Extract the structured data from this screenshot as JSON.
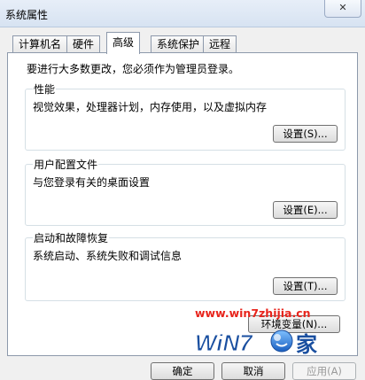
{
  "window": {
    "title": "系统属性",
    "close_label": "✕"
  },
  "tabs": [
    {
      "label": "计算机名",
      "active": false
    },
    {
      "label": "硬件",
      "active": false
    },
    {
      "label": "高级",
      "active": true
    },
    {
      "label": "系统保护",
      "active": false
    },
    {
      "label": "远程",
      "active": false
    }
  ],
  "intro_text": "要进行大多数更改，您必须作为管理员登录。",
  "groups": {
    "performance": {
      "title": "性能",
      "description": "视觉效果，处理器计划，内存使用，以及虚拟内存",
      "button_label": "设置(S)..."
    },
    "user_profiles": {
      "title": "用户配置文件",
      "description": "与您登录有关的桌面设置",
      "button_label": "设置(E)..."
    },
    "startup_recovery": {
      "title": "启动和故障恢复",
      "description": "系统启动、系统失败和调试信息",
      "button_label": "设置(T)..."
    }
  },
  "env_button_label": "环境变量(N)...",
  "footer": {
    "ok_label": "确定",
    "cancel_label": "取消",
    "apply_label": "应用(A)"
  },
  "watermark": {
    "url": "www.win7zhijia.cn",
    "logo_text": "WiN7",
    "logo_suffix": "家",
    "logo_icon": "smiley-ball-icon"
  },
  "colors": {
    "watermark_red": "#e8241c",
    "logo_blue": "#1a4fa0"
  }
}
